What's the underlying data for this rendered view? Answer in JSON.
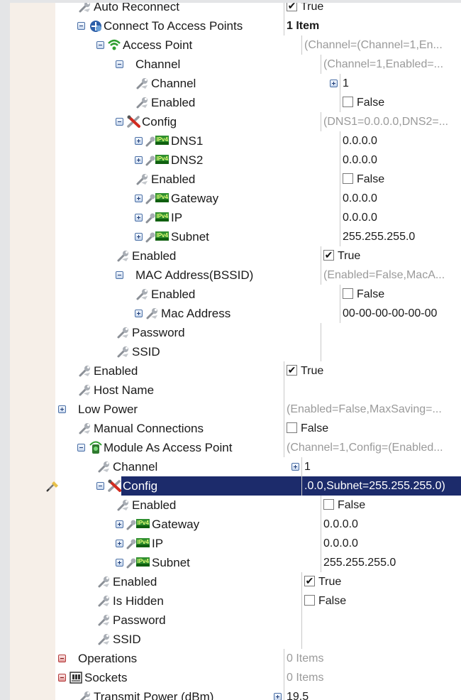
{
  "colors": {
    "selection": "#1c2b6b",
    "gutter": "#f6efe8",
    "grey_text": "#9a9a9a"
  },
  "rows": [
    {
      "label": "Auto Reconnect",
      "value": "True",
      "indent": 1,
      "icon": "wrench-icon",
      "check": "checked",
      "exp": null,
      "vx": 386
    },
    {
      "label": "Connect To Access Points",
      "value": "1 Item",
      "indent": 1,
      "icon": "plugin-icon",
      "exp": "minus",
      "vstyle": "bold",
      "vx": 386
    },
    {
      "label": "Access Point",
      "value": "(Channel=(Channel=1,En...",
      "indent": 2,
      "icon": "wifi-icon",
      "exp": "minus",
      "vstyle": "grey",
      "vx": 411
    },
    {
      "label": "Channel",
      "value": "(Channel=1,Enabled=...",
      "indent": 3,
      "icon": null,
      "exp": "minus",
      "vstyle": "grey",
      "vx": 438
    },
    {
      "label": "Channel",
      "value": "1",
      "indent": 4,
      "icon": "wrench-icon",
      "exp": null,
      "vx": 465,
      "vexp": true
    },
    {
      "label": "Enabled",
      "value": "False",
      "indent": 4,
      "icon": "wrench-icon",
      "exp": null,
      "check": "unchecked",
      "vx": 465
    },
    {
      "label": "Config",
      "value": "(DNS1=0.0.0.0,DNS2=...",
      "indent": 3,
      "icon": "tools-icon",
      "exp": "minus",
      "vstyle": "grey",
      "vx": 438
    },
    {
      "label": "DNS1",
      "value": "0.0.0.0",
      "indent": 4,
      "icon": "ip-icon",
      "exp": "plus",
      "vx": 465
    },
    {
      "label": "DNS2",
      "value": "0.0.0.0",
      "indent": 4,
      "icon": "ip-icon",
      "exp": "plus",
      "vx": 465
    },
    {
      "label": "Enabled",
      "value": "False",
      "indent": 4,
      "icon": "wrench-icon",
      "exp": null,
      "check": "unchecked",
      "vx": 465
    },
    {
      "label": "Gateway",
      "value": "0.0.0.0",
      "indent": 4,
      "icon": "ip-icon",
      "exp": "plus",
      "vx": 465
    },
    {
      "label": "IP",
      "value": "0.0.0.0",
      "indent": 4,
      "icon": "ip-icon",
      "exp": "plus",
      "vx": 465
    },
    {
      "label": "Subnet",
      "value": "255.255.255.0",
      "indent": 4,
      "icon": "ip-icon",
      "exp": "plus",
      "vx": 465
    },
    {
      "label": "Enabled",
      "value": "True",
      "indent": 3,
      "icon": "wrench-icon",
      "exp": null,
      "check": "checked",
      "vx": 438
    },
    {
      "label": "MAC Address(BSSID)",
      "value": "(Enabled=False,MacA...",
      "indent": 3,
      "icon": null,
      "exp": "minus",
      "vstyle": "grey",
      "vx": 438
    },
    {
      "label": "Enabled",
      "value": "False",
      "indent": 4,
      "icon": "wrench-icon",
      "exp": null,
      "check": "unchecked",
      "vx": 465
    },
    {
      "label": "Mac Address",
      "value": "00-00-00-00-00-00",
      "indent": 4,
      "icon": "wrench-icon",
      "exp": "plus",
      "vx": 465
    },
    {
      "label": "Password",
      "value": "",
      "indent": 3,
      "icon": "wrench-icon",
      "exp": null,
      "vx": 438
    },
    {
      "label": "SSID",
      "value": "",
      "indent": 3,
      "icon": "wrench-icon",
      "exp": null,
      "vx": 438
    },
    {
      "label": "Enabled",
      "value": "True",
      "indent": 1,
      "icon": "wrench-icon",
      "exp": null,
      "check": "checked",
      "vx": 386
    },
    {
      "label": "Host Name",
      "value": "",
      "indent": 1,
      "icon": "wrench-icon",
      "exp": null,
      "vx": 386
    },
    {
      "label": "Low Power",
      "value": "(Enabled=False,MaxSaving=...",
      "indent": 0,
      "icon": null,
      "exp": "plus",
      "vstyle": "grey",
      "vx": 386
    },
    {
      "label": "Manual Connections",
      "value": "False",
      "indent": 1,
      "icon": "wrench-icon",
      "exp": null,
      "check": "unchecked",
      "vx": 386
    },
    {
      "label": "Module As Access Point",
      "value": "(Channel=1,Config=(Enabled...",
      "indent": 1,
      "icon": "antenna-icon",
      "exp": "minus",
      "vstyle": "grey",
      "vx": 386
    },
    {
      "label": "Channel",
      "value": "1",
      "indent": 2,
      "icon": "wrench-icon",
      "exp": null,
      "vx": 411,
      "vexp": true
    },
    {
      "label": "Config",
      "value": ".0.0,Subnet=255.255.255.0)",
      "indent": 2,
      "icon": "tools-icon",
      "exp": "minus",
      "selected": true,
      "edit": true,
      "vx": 411
    },
    {
      "label": "Enabled",
      "value": "False",
      "indent": 3,
      "icon": "wrench-icon",
      "exp": null,
      "check": "unchecked",
      "vx": 438
    },
    {
      "label": "Gateway",
      "value": "0.0.0.0",
      "indent": 3,
      "icon": "ip-icon",
      "exp": "plus",
      "vx": 438
    },
    {
      "label": "IP",
      "value": "0.0.0.0",
      "indent": 3,
      "icon": "ip-icon",
      "exp": "plus",
      "vx": 438
    },
    {
      "label": "Subnet",
      "value": "255.255.255.0",
      "indent": 3,
      "icon": "ip-icon",
      "exp": "plus",
      "vx": 438
    },
    {
      "label": "Enabled",
      "value": "True",
      "indent": 2,
      "icon": "wrench-icon",
      "exp": null,
      "check": "checked",
      "vx": 411
    },
    {
      "label": "Is Hidden",
      "value": "False",
      "indent": 2,
      "icon": "wrench-icon",
      "exp": null,
      "check": "unchecked",
      "vx": 411
    },
    {
      "label": "Password",
      "value": "",
      "indent": 2,
      "icon": "wrench-icon",
      "exp": null,
      "vx": 411
    },
    {
      "label": "SSID",
      "value": "",
      "indent": 2,
      "icon": "wrench-icon",
      "exp": null,
      "vx": 411
    },
    {
      "label": "Operations",
      "value": "0 Items",
      "indent": 0,
      "icon": null,
      "exp": "red",
      "vstyle": "grey",
      "vx": 386
    },
    {
      "label": "Sockets",
      "value": "0 Items",
      "indent": 0,
      "icon": "socket-icon",
      "exp": "red",
      "vstyle": "grey",
      "vx": 386
    },
    {
      "label": "Transmit Power (dBm)",
      "value": "19.5",
      "indent": 1,
      "icon": "wrench-icon",
      "exp": null,
      "vx": 386,
      "vexp": true
    }
  ]
}
